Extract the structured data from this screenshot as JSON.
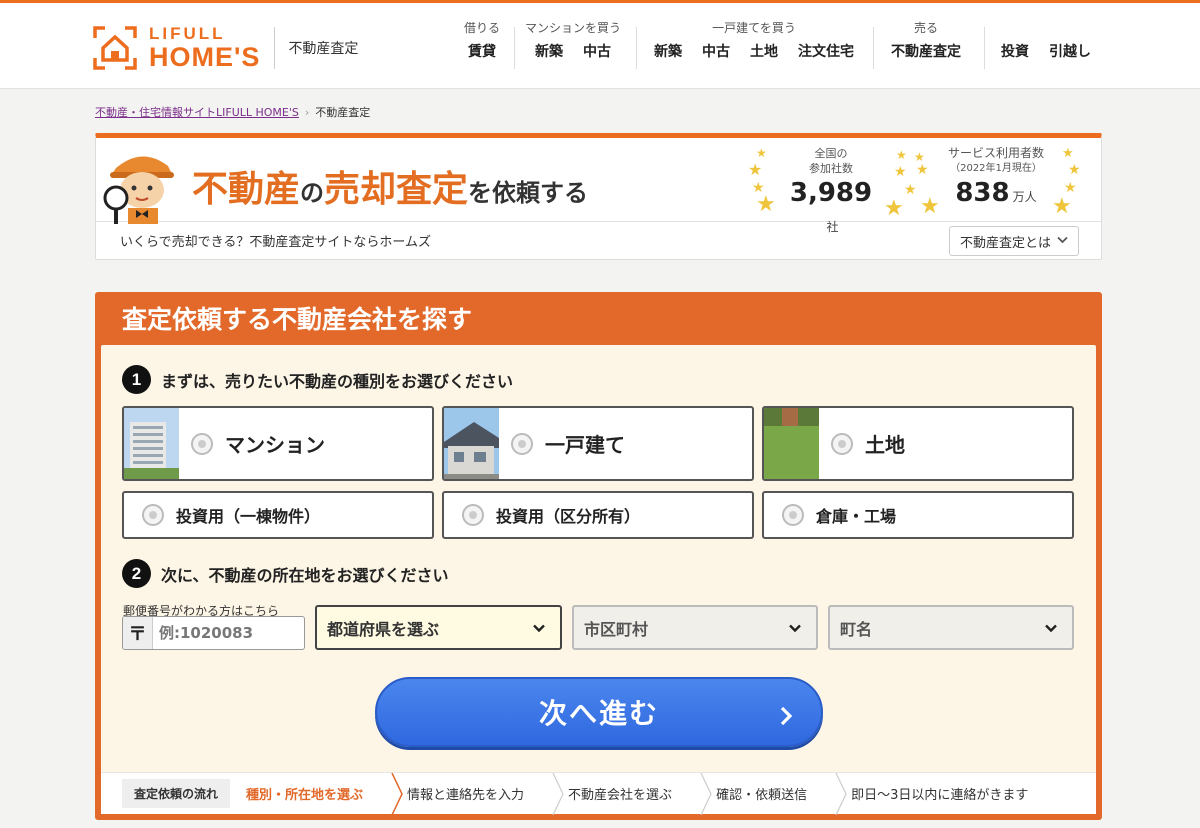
{
  "header": {
    "logo_line1": "LIFULL",
    "logo_line2": "HOME'S",
    "logo_sub": "不動産査定",
    "nav": [
      {
        "category": "借りる",
        "links": [
          "賃貸"
        ]
      },
      {
        "category": "マンションを買う",
        "links": [
          "新築",
          "中古"
        ]
      },
      {
        "category": "一戸建てを買う",
        "links": [
          "新築",
          "中古",
          "土地",
          "注文住宅"
        ]
      },
      {
        "category": "売る",
        "links": [
          "不動産査定"
        ]
      },
      {
        "category": "",
        "links": [
          "投資",
          "引越し"
        ]
      }
    ]
  },
  "breadcrumb": {
    "home": "不動産・住宅情報サイトLIFULL HOME'S",
    "current": "不動産査定"
  },
  "banner": {
    "title_part1": "不動産",
    "title_part2": "の",
    "title_part3": "売却査定",
    "title_part4": "を依頼する",
    "stat1_label1": "全国の",
    "stat1_label2": "参加社数",
    "stat1_value": "3,989",
    "stat1_unit": "社",
    "stat2_label1": "サービス利用者数",
    "stat2_label2": "（2022年1月現在）",
    "stat2_value": "838",
    "stat2_unit": "万人",
    "subtitle": "いくらで売却できる？不動産査定サイトならホームズ",
    "about_button": "不動産査定とは"
  },
  "form": {
    "title": "査定依頼する不動産会社を探す",
    "step1_num": "1",
    "step1_text": "まずは、売りたい不動産の種別をお選びください",
    "property_types": [
      "マンション",
      "一戸建て",
      "土地"
    ],
    "property_types_small": [
      "投資用（一棟物件）",
      "投資用（区分所有）",
      "倉庫・工場"
    ],
    "step2_num": "2",
    "step2_text": "次に、不動産の所在地をお選びください",
    "zip_label": "郵便番号がわかる方はこちら",
    "zip_icon": "〒",
    "zip_placeholder": "例:1020083",
    "prefecture_select": "都道府県を選ぶ",
    "city_select": "市区町村",
    "town_select": "町名",
    "next_button": "次へ進む"
  },
  "flow": {
    "label": "査定依頼の流れ",
    "steps": [
      "種別・所在地を選ぶ",
      "情報と連絡先を入力",
      "不動産会社を選ぶ",
      "確認・依頼送信",
      "即日〜3日以内に連絡がきます"
    ]
  },
  "colors": {
    "brand_orange": "#ed6d1f",
    "panel_orange": "#e2692a",
    "button_blue": "#3a74e6",
    "star_gold": "#efc53b"
  }
}
